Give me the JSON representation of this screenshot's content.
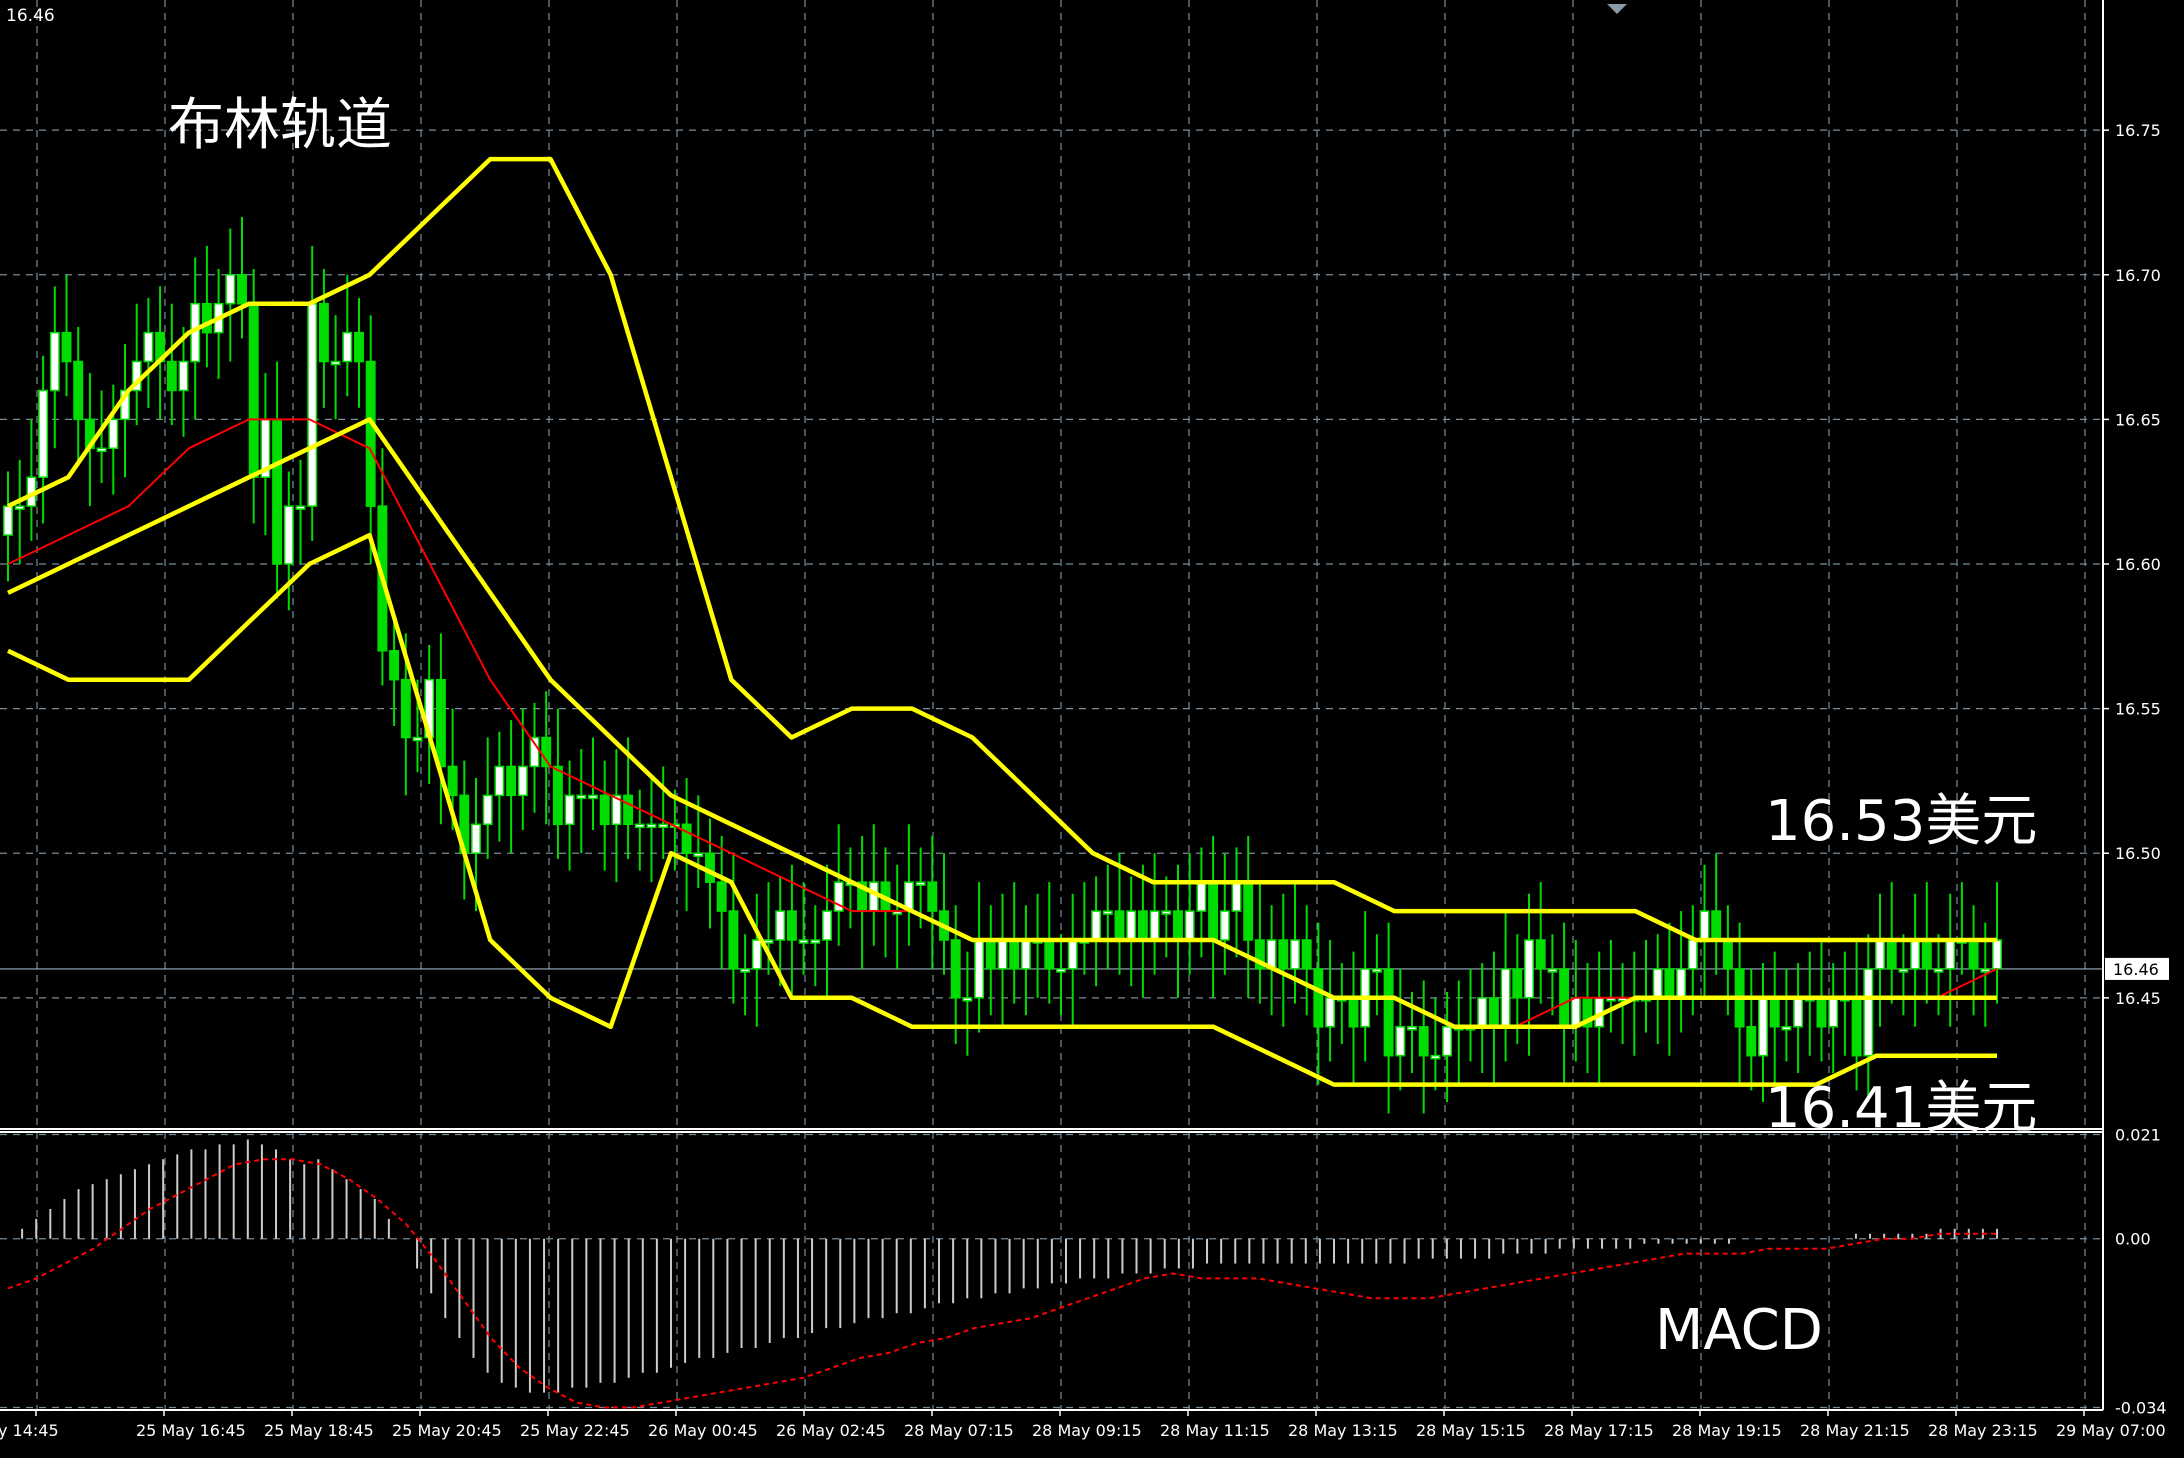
{
  "colors": {
    "background": "#000000",
    "grid": "#7a8c98",
    "frame": "#ffffff",
    "bullish_candle": "#00dd00",
    "bullish_body": "#ffffff",
    "bearish_body": "#00dd00",
    "bollinger": "#ffff00",
    "moving_average": "#ff0000",
    "histogram": "#cccccc",
    "signal_line": "#ff0000",
    "text": "#ffffff"
  },
  "chart_data": [
    {
      "type": "candlestick",
      "title": "布林轨道",
      "current_price": "16.46",
      "corner_label": "16.46",
      "yticks": [
        "16.75",
        "16.70",
        "16.65",
        "16.60",
        "16.55",
        "16.50",
        "16.45"
      ],
      "ylim": [
        16.405,
        16.795
      ],
      "xticks": [
        "y 14:45",
        "25 May 16:45",
        "25 May 18:45",
        "25 May 20:45",
        "25 May 22:45",
        "26 May 00:45",
        "26 May 02:45",
        "28 May 07:15",
        "28 May 09:15",
        "28 May 11:15",
        "28 May 13:15",
        "28 May 15:15",
        "28 May 17:15",
        "28 May 19:15",
        "28 May 21:15",
        "28 May 23:15",
        "29 May 07:00"
      ],
      "annotations": [
        {
          "text": "16.53美元",
          "value": 16.53
        },
        {
          "text": "16.41美元",
          "value": 16.41
        }
      ],
      "grid": true,
      "close": [
        16.62,
        16.62,
        16.63,
        16.66,
        16.68,
        16.67,
        16.65,
        16.64,
        16.64,
        16.65,
        16.66,
        16.67,
        16.68,
        16.67,
        16.66,
        16.67,
        16.69,
        16.68,
        16.69,
        16.7,
        16.69,
        16.63,
        16.65,
        16.6,
        16.62,
        16.62,
        16.69,
        16.67,
        16.67,
        16.68,
        16.67,
        16.62,
        16.57,
        16.56,
        16.54,
        16.54,
        16.56,
        16.53,
        16.52,
        16.5,
        16.51,
        16.52,
        16.53,
        16.52,
        16.53,
        16.54,
        16.53,
        16.51,
        16.52,
        16.52,
        16.52,
        16.51,
        16.52,
        16.51,
        16.51,
        16.51,
        16.51,
        16.51,
        16.5,
        16.5,
        16.49,
        16.48,
        16.46,
        16.46,
        16.47,
        16.47,
        16.48,
        16.47,
        16.47,
        16.47,
        16.48,
        16.49,
        16.49,
        16.48,
        16.49,
        16.48,
        16.48,
        16.49,
        16.49,
        16.48,
        16.47,
        16.45,
        16.45,
        16.47,
        16.46,
        16.47,
        16.46,
        16.47,
        16.47,
        16.46,
        16.46,
        16.47,
        16.47,
        16.48,
        16.48,
        16.47,
        16.48,
        16.47,
        16.48,
        16.48,
        16.47,
        16.48,
        16.49,
        16.47,
        16.48,
        16.49,
        16.47,
        16.46,
        16.47,
        16.46,
        16.47,
        16.46,
        16.44,
        16.45,
        16.45,
        16.44,
        16.46,
        16.46,
        16.43,
        16.44,
        16.44,
        16.43,
        16.43,
        16.44,
        16.44,
        16.44,
        16.45,
        16.44,
        16.46,
        16.45,
        16.47,
        16.46,
        16.46,
        16.44,
        16.45,
        16.44,
        16.45,
        16.45,
        16.45,
        16.45,
        16.45,
        16.46,
        16.45,
        16.46,
        16.47,
        16.48,
        16.47,
        16.46,
        16.44,
        16.43,
        16.45,
        16.44,
        16.44,
        16.45,
        16.45,
        16.44,
        16.45,
        16.45,
        16.43,
        16.46,
        16.47,
        16.46,
        16.46,
        16.47,
        16.46,
        16.46,
        16.47,
        16.47,
        16.46,
        16.46,
        16.47
      ],
      "bollinger": {
        "upper": [
          16.62,
          16.63,
          16.66,
          16.68,
          16.69,
          16.69,
          16.7,
          16.72,
          16.74,
          16.74,
          16.7,
          16.63,
          16.56,
          16.54,
          16.55,
          16.55,
          16.54,
          16.52,
          16.5,
          16.49,
          16.49,
          16.49,
          16.49,
          16.48,
          16.48,
          16.48,
          16.48,
          16.48,
          16.47,
          16.47,
          16.47,
          16.47,
          16.47,
          16.47
        ],
        "middle": [
          16.59,
          16.6,
          16.61,
          16.62,
          16.63,
          16.64,
          16.65,
          16.62,
          16.59,
          16.56,
          16.54,
          16.52,
          16.51,
          16.5,
          16.49,
          16.48,
          16.47,
          16.47,
          16.47,
          16.47,
          16.47,
          16.46,
          16.45,
          16.45,
          16.44,
          16.44,
          16.44,
          16.45,
          16.45,
          16.45,
          16.45,
          16.45,
          16.45,
          16.45
        ],
        "lower": [
          16.57,
          16.56,
          16.56,
          16.56,
          16.58,
          16.6,
          16.61,
          16.54,
          16.47,
          16.45,
          16.44,
          16.5,
          16.49,
          16.45,
          16.45,
          16.44,
          16.44,
          16.44,
          16.44,
          16.44,
          16.44,
          16.43,
          16.42,
          16.42,
          16.42,
          16.42,
          16.42,
          16.42,
          16.42,
          16.42,
          16.42,
          16.43,
          16.43,
          16.43
        ]
      },
      "moving_average": [
        16.6,
        16.61,
        16.62,
        16.64,
        16.65,
        16.65,
        16.64,
        16.6,
        16.56,
        16.53,
        16.52,
        16.51,
        16.5,
        16.49,
        16.48,
        16.48,
        16.47,
        16.47,
        16.47,
        16.47,
        16.47,
        16.46,
        16.45,
        16.45,
        16.44,
        16.44,
        16.45,
        16.45,
        16.45,
        16.45,
        16.45,
        16.45,
        16.45,
        16.46
      ]
    },
    {
      "type": "histogram",
      "title": "MACD",
      "yticks": [
        "0.021",
        "0.00",
        "-0.034"
      ],
      "ylim": [
        -0.0345,
        0.0215
      ],
      "histogram": [
        0.0,
        0.002,
        0.004,
        0.006,
        0.008,
        0.01,
        0.011,
        0.012,
        0.013,
        0.014,
        0.015,
        0.016,
        0.017,
        0.018,
        0.018,
        0.019,
        0.019,
        0.02,
        0.019,
        0.018,
        0.016,
        0.015,
        0.016,
        0.014,
        0.012,
        0.01,
        0.008,
        0.004,
        0.0,
        -0.006,
        -0.011,
        -0.016,
        -0.02,
        -0.024,
        -0.027,
        -0.029,
        -0.03,
        -0.031,
        -0.031,
        -0.031,
        -0.03,
        -0.03,
        -0.029,
        -0.029,
        -0.028,
        -0.027,
        -0.027,
        -0.026,
        -0.025,
        -0.024,
        -0.024,
        -0.023,
        -0.022,
        -0.022,
        -0.021,
        -0.02,
        -0.02,
        -0.019,
        -0.018,
        -0.018,
        -0.017,
        -0.016,
        -0.016,
        -0.015,
        -0.015,
        -0.014,
        -0.013,
        -0.013,
        -0.012,
        -0.012,
        -0.011,
        -0.011,
        -0.01,
        -0.01,
        -0.009,
        -0.009,
        -0.008,
        -0.008,
        -0.008,
        -0.007,
        -0.007,
        -0.007,
        -0.006,
        -0.006,
        -0.006,
        -0.005,
        -0.005,
        -0.005,
        -0.005,
        -0.005,
        -0.005,
        -0.005,
        -0.005,
        -0.005,
        -0.005,
        -0.005,
        -0.005,
        -0.005,
        -0.005,
        -0.005,
        -0.004,
        -0.004,
        -0.004,
        -0.004,
        -0.004,
        -0.004,
        -0.003,
        -0.003,
        -0.003,
        -0.003,
        -0.002,
        -0.002,
        -0.002,
        -0.002,
        -0.002,
        -0.002,
        -0.001,
        -0.001,
        -0.001,
        -0.001,
        -0.001,
        -0.001,
        -0.001,
        0.0,
        0.0,
        0.0,
        0.0,
        0.0,
        0.0,
        0.0,
        0.0,
        0.001,
        0.001,
        0.001,
        0.001,
        0.001,
        0.001,
        0.002,
        0.002,
        0.002,
        0.002,
        0.002
      ],
      "signal": [
        -0.01,
        -0.008,
        -0.005,
        -0.002,
        0.002,
        0.006,
        0.009,
        0.012,
        0.015,
        0.016,
        0.016,
        0.015,
        0.012,
        0.008,
        0.003,
        -0.004,
        -0.012,
        -0.02,
        -0.026,
        -0.03,
        -0.033,
        -0.034,
        -0.034,
        -0.033,
        -0.032,
        -0.031,
        -0.03,
        -0.029,
        -0.028,
        -0.026,
        -0.024,
        -0.023,
        -0.021,
        -0.02,
        -0.018,
        -0.017,
        -0.016,
        -0.014,
        -0.012,
        -0.01,
        -0.008,
        -0.007,
        -0.008,
        -0.008,
        -0.008,
        -0.009,
        -0.01,
        -0.011,
        -0.012,
        -0.012,
        -0.012,
        -0.011,
        -0.01,
        -0.009,
        -0.008,
        -0.007,
        -0.006,
        -0.005,
        -0.004,
        -0.003,
        -0.003,
        -0.003,
        -0.002,
        -0.002,
        -0.002,
        -0.001,
        0.0,
        0.0,
        0.001,
        0.001,
        0.001
      ]
    }
  ],
  "labels": {
    "title": "布林轨道",
    "upper_annotation": "16.53美元",
    "lower_annotation": "16.41美元",
    "macd_label": "MACD",
    "corner": "16.46"
  }
}
